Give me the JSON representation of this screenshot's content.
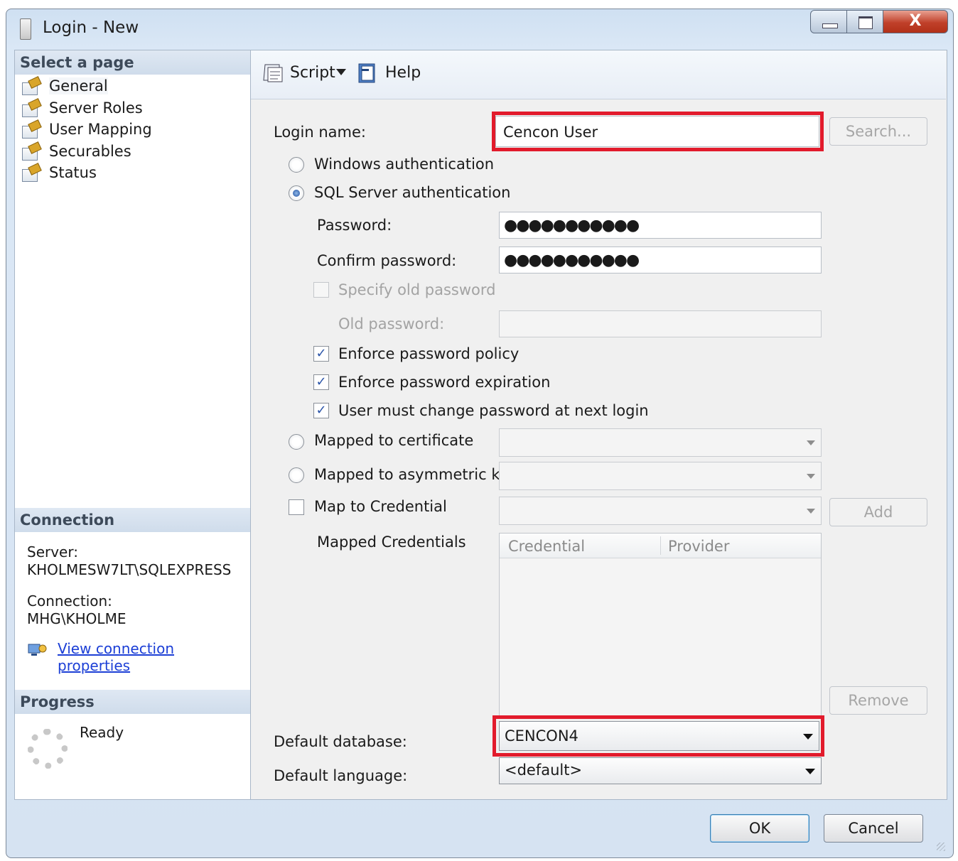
{
  "window": {
    "title": "Login - New",
    "close_glyph": "X"
  },
  "left_pane": {
    "select_page_header": "Select a page",
    "pages": [
      {
        "label": "General",
        "icon": "page-wrench-icon",
        "selected": true
      },
      {
        "label": "Server Roles",
        "icon": "page-wrench-icon",
        "selected": false
      },
      {
        "label": "User Mapping",
        "icon": "page-wrench-icon",
        "selected": false
      },
      {
        "label": "Securables",
        "icon": "page-wrench-icon",
        "selected": false
      },
      {
        "label": "Status",
        "icon": "page-wrench-icon",
        "selected": false
      }
    ],
    "connection_header": "Connection",
    "server_label": "Server:",
    "server_value": "KHOLMESW7LT\\SQLEXPRESS",
    "connection_label": "Connection:",
    "connection_value": "MHG\\KHOLME",
    "view_connection_link": "View connection properties",
    "progress_header": "Progress",
    "progress_status": "Ready"
  },
  "toolbar": {
    "script_label": "Script",
    "help_label": "Help"
  },
  "form": {
    "login_name_label": "Login name:",
    "login_name_value": "Cencon User",
    "search_button": "Search...",
    "windows_auth_label": "Windows authentication",
    "sql_auth_label": "SQL Server authentication",
    "auth_selected": "sql",
    "password_label": "Password:",
    "password_value": "●●●●●●●●●●●",
    "confirm_password_label": "Confirm password:",
    "confirm_password_value": "●●●●●●●●●●●",
    "specify_old_password_label": "Specify old password",
    "old_password_label": "Old password:",
    "enforce_policy_label": "Enforce password policy",
    "enforce_policy_checked": true,
    "enforce_expiration_label": "Enforce password expiration",
    "enforce_expiration_checked": true,
    "must_change_label": "User must change password at next login",
    "must_change_checked": true,
    "mapped_certificate_label": "Mapped to certificate",
    "mapped_asym_key_label": "Mapped to asymmetric key",
    "map_credential_label": "Map to Credential",
    "add_button": "Add",
    "mapped_credentials_label": "Mapped Credentials",
    "credentials_columns": [
      "Credential",
      "Provider"
    ],
    "remove_button": "Remove",
    "default_database_label": "Default database:",
    "default_database_value": "CENCON4",
    "default_language_label": "Default language:",
    "default_language_value": "<default>",
    "checkmark_glyph": "✓"
  },
  "footer": {
    "ok_button": "OK",
    "cancel_button": "Cancel"
  },
  "colors": {
    "highlight_border": "#e21b2c",
    "link": "#1c3fd6"
  }
}
